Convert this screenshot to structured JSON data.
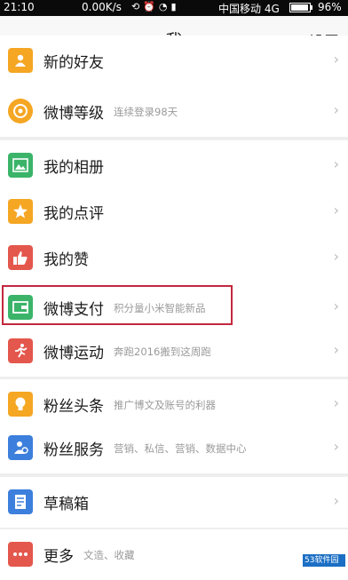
{
  "status_bar": {
    "time": "21:10",
    "network_speed": "0.00K/s",
    "carrier": "中国移动 4G",
    "battery": "96%",
    "battery_level": 0.96
  },
  "nav": {
    "title": "我",
    "settings_label": "设置"
  },
  "menu": {
    "new_friends": {
      "label": "新的好友",
      "icon": "person-icon"
    },
    "weibo_level": {
      "label": "微博等级",
      "sub": "连续登录98天",
      "icon": "level-badge-icon"
    },
    "my_album": {
      "label": "我的相册",
      "icon": "image-icon"
    },
    "my_reviews": {
      "label": "我的点评",
      "icon": "review-star-icon"
    },
    "my_likes": {
      "label": "我的赞",
      "icon": "thumbs-up-icon"
    },
    "weibo_pay": {
      "label": "微博支付",
      "sub": "积分量小米智能新品",
      "icon": "wallet-icon"
    },
    "weibo_sports": {
      "label": "微博运动",
      "sub": "奔跑2016搬到这周跑",
      "icon": "runner-icon"
    },
    "fan_headlines": {
      "label": "粉丝头条",
      "sub": "推广博文及账号的利器",
      "icon": "lightbulb-icon"
    },
    "fan_service": {
      "label": "粉丝服务",
      "sub": "营销、私信、营销、数据中心",
      "icon": "fan-person-icon"
    },
    "drafts": {
      "label": "草稿箱",
      "icon": "document-icon"
    },
    "more": {
      "label": "更多",
      "sub": "文造、收藏",
      "icon": "more-dots-icon"
    }
  },
  "colors": {
    "accent_orange": "#f5a623",
    "green": "#3bb46a",
    "red": "#e4574c",
    "blue": "#3d7fdc",
    "highlight_red": "#c2283e"
  },
  "watermark": "53软件园"
}
